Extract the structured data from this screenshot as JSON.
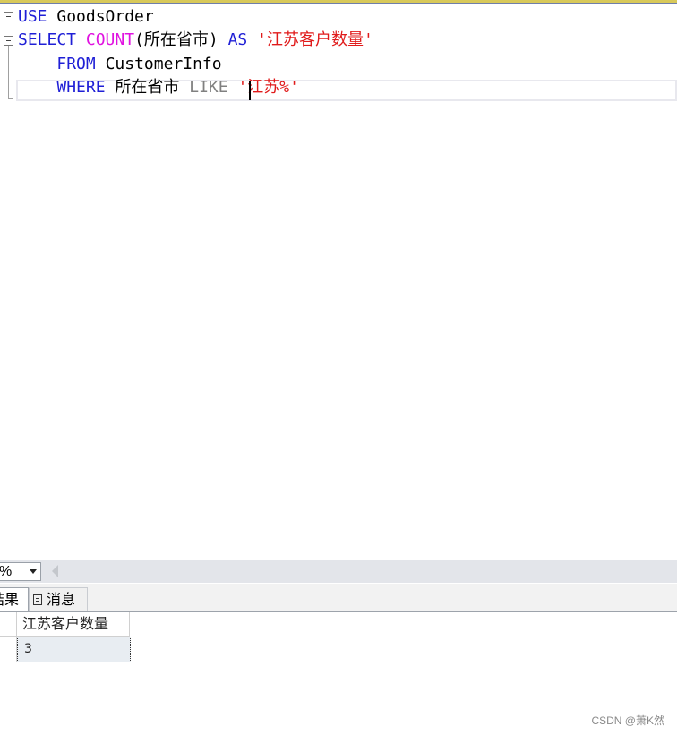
{
  "editor": {
    "line1": {
      "kw": "USE",
      "db": "GoodsOrder"
    },
    "line2": {
      "kw1": "SELECT",
      "fn": "COUNT",
      "args": "(所在省市)",
      "kw2": "AS",
      "alias": "'江苏客户数量'"
    },
    "line3": {
      "kw": "FROM",
      "table": "CustomerInfo"
    },
    "line4": {
      "kw": "WHERE",
      "column": "所在省市",
      "op": "LIKE",
      "pattern": "'江苏%'"
    }
  },
  "status": {
    "zoom": "%"
  },
  "tabs": {
    "results": "结果",
    "messages": "消息"
  },
  "results_grid": {
    "columns": [
      "江苏客户数量"
    ],
    "rows": [
      [
        "3"
      ]
    ]
  },
  "watermark": "CSDN @萧K然",
  "colors": {
    "keyword": "#1f1fd6",
    "function": "#e012e0",
    "string": "#e01a1a",
    "operator": "#808080"
  },
  "icons": [
    "collapse-icon",
    "dropdown-arrow-icon",
    "scroll-left-icon",
    "messages-icon"
  ]
}
